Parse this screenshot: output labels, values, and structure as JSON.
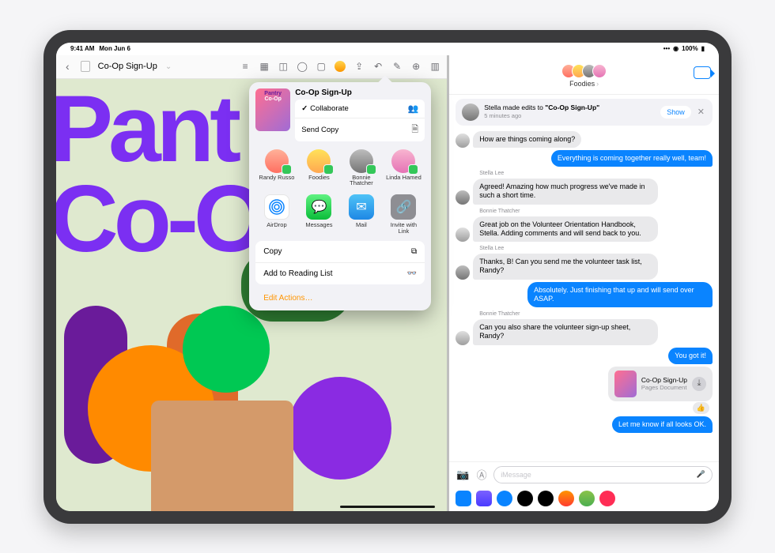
{
  "status": {
    "time": "9:41 AM",
    "date": "Mon Jun 6",
    "battery": "100%"
  },
  "pages": {
    "doc_title": "Co-Op Sign-Up",
    "canvas_line1": "Pant",
    "canvas_line2": "Co-O"
  },
  "share": {
    "title": "Co-Op Sign-Up",
    "thumb_t1": "Pantry",
    "thumb_t2": "Co-Op",
    "collaborate": "Collaborate",
    "send_copy": "Send Copy",
    "people": [
      {
        "name": "Randy Russo"
      },
      {
        "name": "Foodies"
      },
      {
        "name": "Bonnie Thatcher"
      },
      {
        "name": "Linda Hamed"
      }
    ],
    "apps": [
      {
        "name": "AirDrop"
      },
      {
        "name": "Messages"
      },
      {
        "name": "Mail"
      },
      {
        "name": "Invite with Link"
      }
    ],
    "copy": "Copy",
    "reading_list": "Add to Reading List",
    "edit_actions": "Edit Actions…"
  },
  "messages": {
    "group_name": "Foodies",
    "banner": {
      "pre": "Stella made edits to ",
      "doc": "\"Co-Op Sign-Up\"",
      "sub": "5 minutes ago",
      "show": "Show"
    },
    "first_partial": "How are things coming along?",
    "thread": [
      {
        "dir": "out",
        "text": "Everything is coming together really well, team!"
      },
      {
        "dir": "in",
        "sender": "Stella Lee",
        "av": "stella",
        "text": "Agreed! Amazing how much progress we've made in such a short time."
      },
      {
        "dir": "in",
        "sender": "Bonnie Thatcher",
        "av": "bonnie",
        "text": "Great job on the Volunteer Orientation Handbook, Stella. Adding comments and will send back to you."
      },
      {
        "dir": "in",
        "sender": "Stella Lee",
        "av": "stella",
        "text": "Thanks, B! Can you send me the volunteer task list, Randy?"
      },
      {
        "dir": "out",
        "text": "Absolutely. Just finishing that up and will send over ASAP."
      },
      {
        "dir": "in",
        "sender": "Bonnie Thatcher",
        "av": "bonnie",
        "text": "Can you also share the volunteer sign-up sheet, Randy?"
      },
      {
        "dir": "out",
        "text": "You got it!"
      }
    ],
    "attachment": {
      "title": "Co-Op Sign-Up",
      "subtitle": "Pages Document"
    },
    "last_out": "Let me know if all looks OK.",
    "input_placeholder": "iMessage"
  }
}
